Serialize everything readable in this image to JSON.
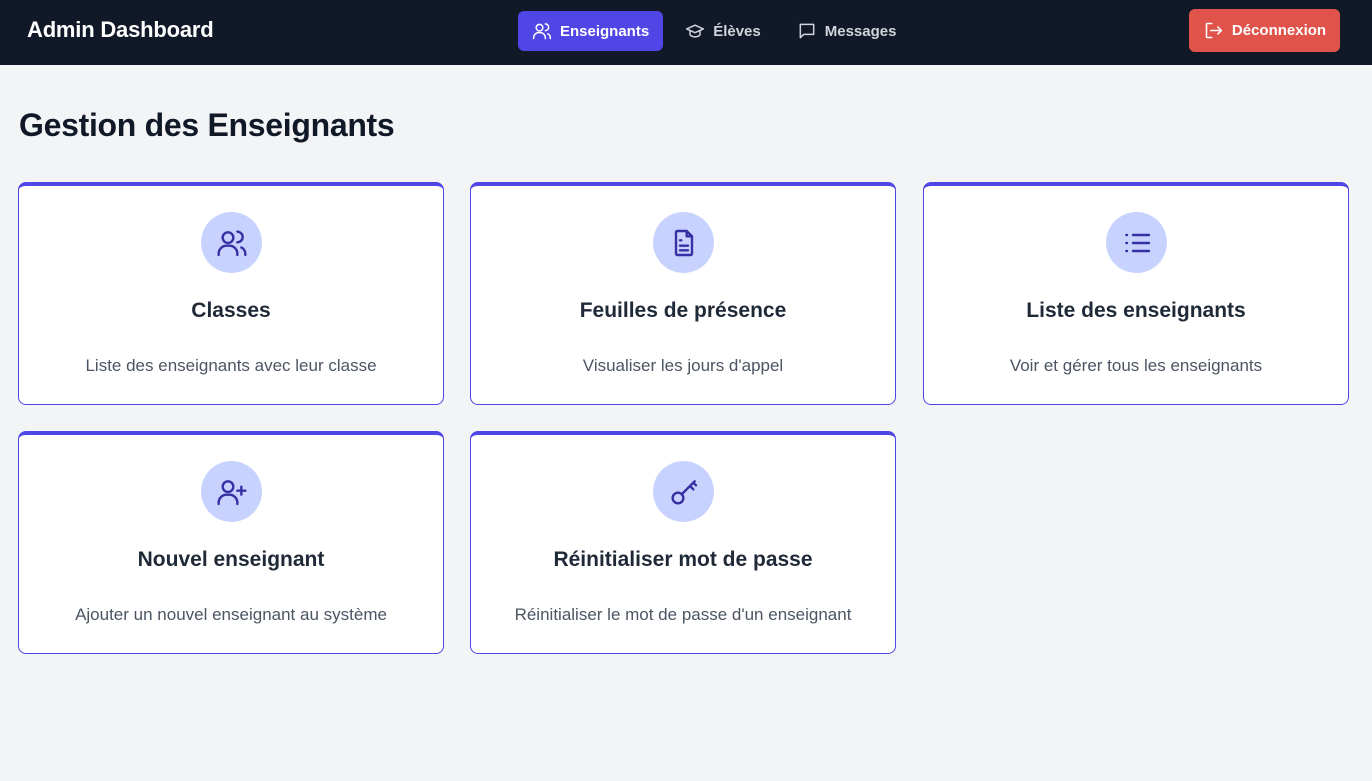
{
  "header": {
    "brand": "Admin Dashboard",
    "nav": [
      {
        "label": "Enseignants",
        "icon": "users-icon",
        "active": true
      },
      {
        "label": "Élèves",
        "icon": "graduation-cap-icon",
        "active": false
      },
      {
        "label": "Messages",
        "icon": "message-icon",
        "active": false
      }
    ],
    "logout_label": "Déconnexion"
  },
  "main": {
    "title": "Gestion des Enseignants",
    "cards": [
      {
        "title": "Classes",
        "description": "Liste des enseignants avec leur classe",
        "icon": "users-icon"
      },
      {
        "title": "Feuilles de présence",
        "description": "Visualiser les jours d'appel",
        "icon": "document-icon"
      },
      {
        "title": "Liste des enseignants",
        "description": "Voir et gérer tous les enseignants",
        "icon": "list-icon"
      },
      {
        "title": "Nouvel enseignant",
        "description": "Ajouter un nouvel enseignant au système",
        "icon": "user-plus-icon"
      },
      {
        "title": "Réinitialiser mot de passe",
        "description": "Réinitialiser le mot de passe d'un enseignant",
        "icon": "key-icon"
      }
    ]
  },
  "colors": {
    "navbar_bg": "#111827",
    "accent": "#4f46e5",
    "logout_bg": "#e0534a",
    "icon_circle_bg": "#c7d2fe",
    "page_bg": "#f3f4f6"
  }
}
